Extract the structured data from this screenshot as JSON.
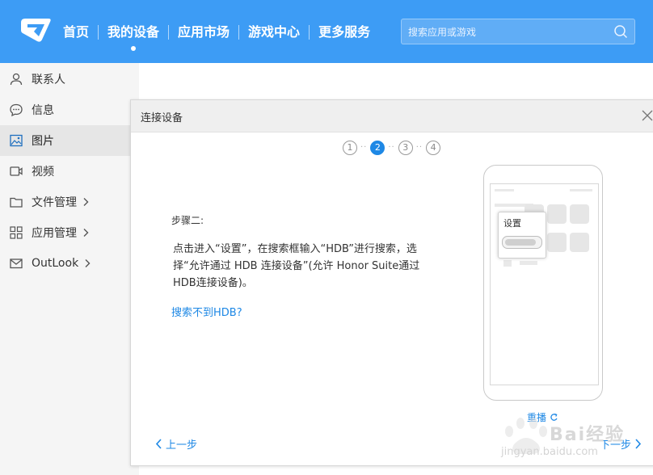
{
  "nav": {
    "items": [
      {
        "label": "首页"
      },
      {
        "label": "我的设备",
        "active": true
      },
      {
        "label": "应用市场"
      },
      {
        "label": "游戏中心"
      },
      {
        "label": "更多服务"
      }
    ]
  },
  "search": {
    "placeholder": "搜索应用或游戏"
  },
  "sidebar": {
    "items": [
      {
        "label": "联系人",
        "icon": "contact-icon"
      },
      {
        "label": "信息",
        "icon": "message-icon"
      },
      {
        "label": "图片",
        "icon": "image-icon",
        "active": true
      },
      {
        "label": "视频",
        "icon": "video-icon"
      },
      {
        "label": "文件管理",
        "icon": "folder-icon",
        "has_submenu": true
      },
      {
        "label": "应用管理",
        "icon": "apps-icon",
        "has_submenu": true
      },
      {
        "label": "OutLook",
        "icon": "mail-icon",
        "has_submenu": true
      }
    ]
  },
  "dialog": {
    "title": "连接设备",
    "steps": [
      "1",
      "2",
      "3",
      "4"
    ],
    "current_step": 2,
    "step_heading": "步骤二:",
    "step_description": "点击进入“设置”，在搜索框输入“HDB”进行搜索，选择“允许通过 HDB 连接设备”(允许 Honor Suite通过HDB连接设备)。",
    "help_link": "搜索不到HDB?",
    "phone_settings_label": "设置",
    "replay_label": "重播",
    "prev_label": "上一步",
    "next_label": "下一步"
  },
  "watermark": {
    "text": "Bai经验",
    "url": "jingyan.baidu.com"
  },
  "colors": {
    "topbar": "#3d9cf5",
    "accent": "#1e88e5",
    "sidebar_bg": "#f5f5f5",
    "active_item_bg": "#e6e6e6"
  }
}
